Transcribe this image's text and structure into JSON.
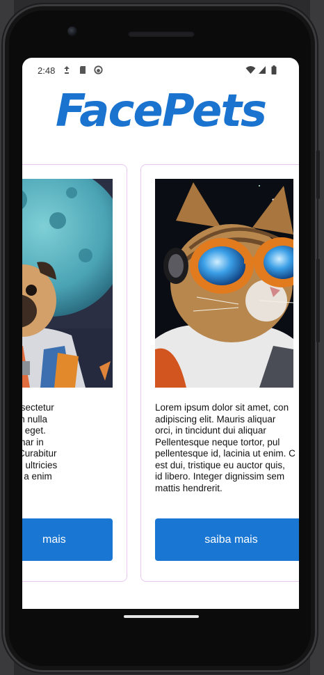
{
  "status_bar": {
    "time": "2:48",
    "icons": [
      "notification-icon",
      "sd-card-icon",
      "app-status-icon",
      "wifi-icon",
      "signal-icon",
      "battery-icon"
    ]
  },
  "app": {
    "title": "FacePets",
    "brand_color": "#1a73cf"
  },
  "cards": [
    {
      "image_subject": "pug astronaut in front of the moon",
      "text": "t amet, consectetur\nuris aliquam nulla\ndui aliquam eget.\ntortor, pulvinar in\na ut enim. Curabitur\nauctor quis, ultricies\nnissim sem a enim",
      "button_label": "mais"
    },
    {
      "image_subject": "cat astronaut wearing orange goggles",
      "text": "Lorem ipsum dolor sit amet, con\nadipiscing elit. Mauris aliquar\norci, in tincidunt dui aliquar\nPellentesque neque tortor, pul\npellentesque id, lacinia ut enim. C\nest dui, tristique eu auctor quis,\nid libero. Integer dignissim sem\nmattis hendrerit.",
      "button_label": "saiba mais"
    }
  ],
  "colors": {
    "button": "#1976d2",
    "card_border": "#e8c7ef"
  }
}
